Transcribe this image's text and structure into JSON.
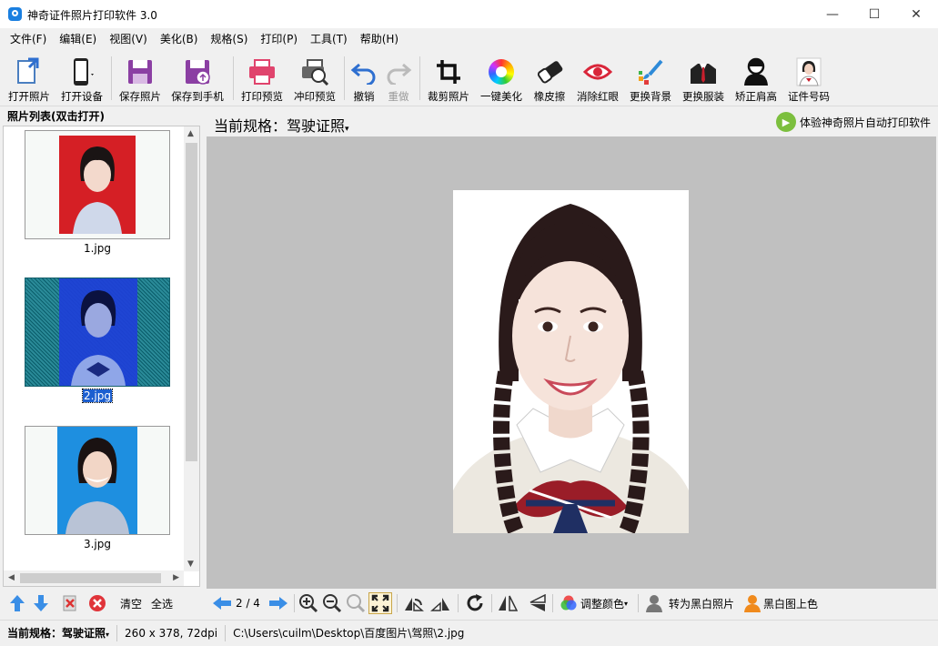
{
  "window": {
    "title": "神奇证件照片打印软件 3.0",
    "minimize": "—",
    "maximize": "☐",
    "close": "✕"
  },
  "menu": [
    "文件(F)",
    "编辑(E)",
    "视图(V)",
    "美化(B)",
    "规格(S)",
    "打印(P)",
    "工具(T)",
    "帮助(H)"
  ],
  "toolbar": {
    "open_photo": "打开照片",
    "open_device": "打开设备",
    "save_photo": "保存照片",
    "save_to_phone": "保存到手机",
    "print_preview": "打印预览",
    "develop_preview": "冲印预览",
    "undo": "撤销",
    "redo": "重做",
    "crop": "裁剪照片",
    "beautify": "一键美化",
    "eraser": "橡皮擦",
    "red_eye": "消除红眼",
    "change_bg": "更换背景",
    "change_clothes": "更换服装",
    "fix_shoulder": "矫正肩高",
    "id_number": "证件号码"
  },
  "photo_list": {
    "header": "照片列表(双击打开)",
    "items": [
      {
        "name": "1.jpg",
        "bg": "#d51f25"
      },
      {
        "name": "2.jpg",
        "bg": "#1e3fd8"
      },
      {
        "name": "3.jpg",
        "bg": "#1e8fe0"
      }
    ],
    "selected": "2.jpg",
    "clear": "清空",
    "select_all": "全选"
  },
  "current_spec": {
    "label": "当前规格：驾驶证照",
    "promo": "体验神奇照片自动打印软件"
  },
  "viewer": {
    "page": "2 / 4",
    "adjust_color": "调整颜色",
    "to_bw": "转为黑白照片",
    "colorize": "黑白图上色"
  },
  "status": {
    "spec_label": "当前规格：",
    "spec_value": "驾驶证照",
    "dims": "260 x 378, 72dpi",
    "path": "C:\\Users\\cuilm\\Desktop\\百度图片\\驾照\\2.jpg"
  },
  "colors": {
    "accent_blue": "#1c5fd0",
    "canvas_gray": "#c0c0c0",
    "promo_green": "#7cbf3e"
  }
}
